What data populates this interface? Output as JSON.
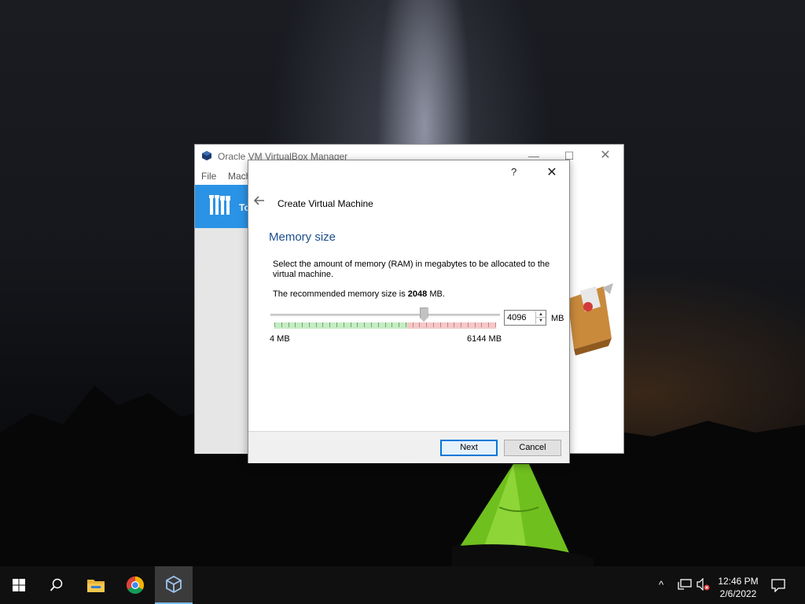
{
  "vbox_manager": {
    "title": "Oracle VM VirtualBox Manager",
    "menu_file": "File",
    "menu_machine": "Mach",
    "tools_label": "To",
    "minimize": "—",
    "maximize": "☐",
    "close": "✕"
  },
  "dialog": {
    "help": "?",
    "close": "✕",
    "back": "🡐",
    "window_title": "Create Virtual Machine",
    "heading": "Memory size",
    "description": "Select the amount of memory (RAM) in megabytes to be allocated to the virtual machine.",
    "recommended_prefix": "The recommended memory size is ",
    "recommended_value": "2048",
    "recommended_suffix": " MB.",
    "slider": {
      "min_label": "4 MB",
      "max_label": "6144 MB",
      "min": 4,
      "max": 6144,
      "value": 4096,
      "recommended": 2048,
      "safe_limit_fraction": 0.6
    },
    "spin_value": "4096",
    "unit": "MB",
    "next_label": "Next",
    "cancel_label": "Cancel"
  },
  "taskbar": {
    "items": [
      "start-icon",
      "search-icon",
      "file-explorer-icon",
      "chrome-icon",
      "virtualbox-icon"
    ],
    "tray_up": "^",
    "time": "12:46 PM",
    "date": "2/6/2022"
  }
}
